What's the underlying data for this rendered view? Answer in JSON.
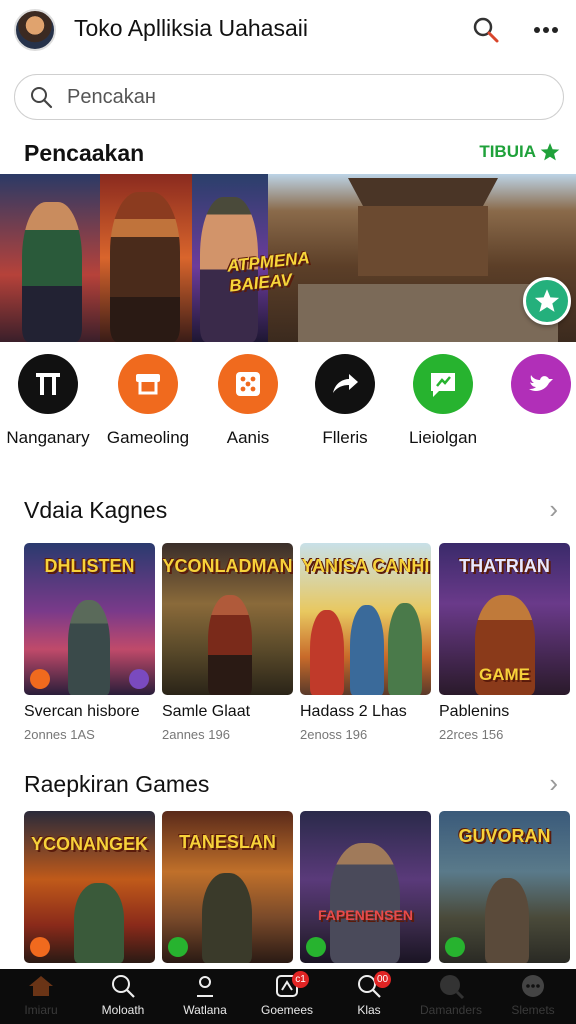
{
  "header": {
    "title": "Toko Aplliksia Uahasaii",
    "avatar": "user-avatar",
    "icons": [
      "search-icon",
      "more-icon"
    ]
  },
  "search": {
    "placeholder": "Pencakaн"
  },
  "featured": {
    "heading": "Pencaakan",
    "see_all_label": "TIBUIA",
    "banner_text": "ATPMENA BAIEAV"
  },
  "categories": [
    {
      "label": "Nanganary",
      "icon": "pi-icon",
      "color": "#111111"
    },
    {
      "label": "Gameoling",
      "icon": "shop-icon",
      "color": "#f06a1e"
    },
    {
      "label": "Aanis",
      "icon": "dice-icon",
      "color": "#f06a1e"
    },
    {
      "label": "Flleris",
      "icon": "share-arrow-icon",
      "color": "#111111"
    },
    {
      "label": "Lieiolgan",
      "icon": "chat-icon",
      "color": "#27b32f"
    },
    {
      "label": "",
      "icon": "bird-icon",
      "color": "#b12fb8"
    }
  ],
  "section1": {
    "title": "Vdaia Kagnes",
    "cards": [
      {
        "name": "Svercan hisbore",
        "meta": "2onnes 1AS",
        "art_title": "DHLISTEN",
        "art_sub": ""
      },
      {
        "name": "Samle Glaat",
        "meta": "2annes 196",
        "art_title": "YCONLADMAN",
        "art_sub": ""
      },
      {
        "name": "Hadass 2 Lhas",
        "meta": "2enoss 196",
        "art_title": "YANISA CANHI",
        "art_sub": ""
      },
      {
        "name": "Pablenins",
        "meta": "22rces 156",
        "art_title": "THATRIAN",
        "art_sub": "GAME"
      }
    ]
  },
  "section2": {
    "title": "Raepkiran Games",
    "cards": [
      {
        "art_title": "YCONANGEK",
        "art_sub": ""
      },
      {
        "art_title": "TANESLAN",
        "art_sub": ""
      },
      {
        "art_title": "",
        "art_sub": "FAPENENSEN"
      },
      {
        "art_title": "GUVORAN",
        "art_sub": ""
      }
    ]
  },
  "nav": [
    {
      "label": "Imiaru",
      "icon": "home-icon",
      "badge": ""
    },
    {
      "label": "Moloath",
      "icon": "search-icon",
      "badge": ""
    },
    {
      "label": "Watlana",
      "icon": "user-icon",
      "badge": ""
    },
    {
      "label": "Goemees",
      "icon": "games-icon",
      "badge": "c1"
    },
    {
      "label": "Klas",
      "icon": "search-icon",
      "badge": "00"
    },
    {
      "label": "Damanders",
      "icon": "search-icon",
      "badge": ""
    },
    {
      "label": "Slemets",
      "icon": "more-icon",
      "badge": ""
    }
  ],
  "colors": {
    "accent_green": "#1fa13a",
    "nav_bg": "#0c0c0c",
    "badge_red": "#e02424"
  }
}
